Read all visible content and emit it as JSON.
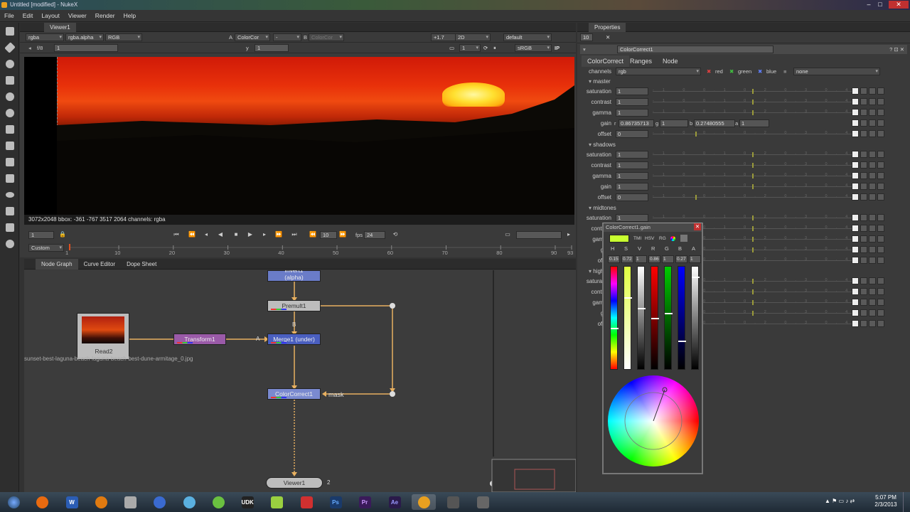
{
  "window": {
    "title": "Untitled [modified] - NukeX"
  },
  "menu": [
    "File",
    "Edit",
    "Layout",
    "Viewer",
    "Render",
    "Help"
  ],
  "viewer": {
    "tab": "Viewer1",
    "channels": "rgba",
    "alpha": "rgba.alpha",
    "display_mode": "RGB",
    "a_label": "A",
    "a_input": "ColorCor",
    "b_dash": "-",
    "b_label": "B",
    "b_input": "ColorCor",
    "gain": "+1.7",
    "view_mode": "2D",
    "lut_default": "default",
    "frame_label": "f/8",
    "frame_value": "1",
    "y_label": "y",
    "y_value": "1",
    "zoom": "1",
    "colorspace": "sRGB",
    "ip": "IP",
    "status": "3072x2048 bbox: -361 -767 3517 2064 channels: rgba",
    "frame_field": "1",
    "play_increment": "10",
    "fps_label": "fps",
    "fps_value": "24",
    "range_mode": "Custom",
    "ticks": [
      "1",
      "10",
      "20",
      "30",
      "40",
      "50",
      "60",
      "70",
      "80",
      "90",
      "93"
    ]
  },
  "nodegraph": {
    "tabs": [
      "Node Graph",
      "Curve Editor",
      "Dope Sheet"
    ],
    "nodes": {
      "invert": "Invert1\n(alpha)",
      "premult": "Premult1",
      "read": "Read2",
      "read_file": "sunset-best-laguna-beach-laguna-beach-best-dune-armitage_0.jpg",
      "transform": "Transform1",
      "merge": "Merge1 (under)",
      "colorcorrect": "ColorCorrect1",
      "viewer": "Viewer1"
    },
    "labels": {
      "a": "A",
      "b": "B",
      "mask": "mask",
      "viewer_input": "2"
    }
  },
  "properties": {
    "title": "Properties",
    "max_panels": "10",
    "node_name": "ColorCorrect1",
    "tabs": [
      "ColorCorrect",
      "Ranges",
      "Node"
    ],
    "channels_label": "channels",
    "channels_value": "rgb",
    "red": "red",
    "green": "green",
    "blue": "blue",
    "mask_value": "none",
    "sections": [
      "master",
      "shadows",
      "midtones",
      "highlights"
    ],
    "params": [
      "saturation",
      "contrast",
      "gamma",
      "gain",
      "offset"
    ],
    "master": {
      "saturation": "1",
      "contrast": "1",
      "gamma": "1",
      "gain_r": "0.86735713",
      "gain_g": "1",
      "gain_b": "0.27480555",
      "gain_a": "1",
      "offset": "0"
    },
    "shadows": {
      "saturation": "1",
      "contrast": "1",
      "gamma": "1",
      "gain": "1",
      "offset": "0"
    },
    "gain_labels": {
      "r": "r",
      "g": "g",
      "b": "b",
      "a": "a"
    },
    "anim_btn": "4"
  },
  "color_picker": {
    "title": "ColorCorrect1.gain",
    "mode_labels": [
      "TMI",
      "HSV",
      "RG"
    ],
    "channels": [
      "H",
      "S",
      "V",
      "R",
      "G",
      "B",
      "A"
    ],
    "values": [
      "0.15",
      "0.72",
      "1",
      "0.86",
      "1",
      "0.27",
      "1"
    ]
  },
  "taskbar": {
    "time": "5:07 PM",
    "date": "2/3/2013"
  },
  "colors": {
    "accent": "#f0a030",
    "viewer_bg": "#000000",
    "panel": "#3a3a3a",
    "node_blue": "#4a5fc0",
    "node_purple": "#8a4a9a"
  }
}
